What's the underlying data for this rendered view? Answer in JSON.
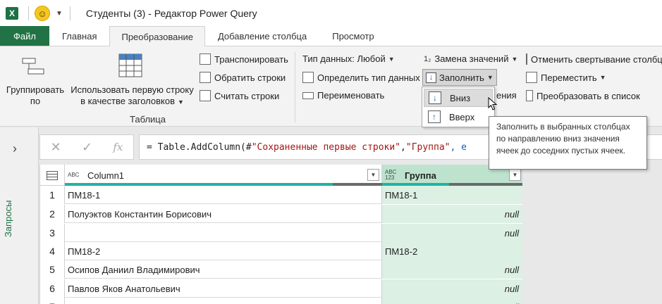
{
  "titlebar": {
    "app_icon": "excel-icon",
    "title": "Студенты (3) - Редактор Power Query"
  },
  "tabs": [
    {
      "label": "Файл"
    },
    {
      "label": "Главная"
    },
    {
      "label": "Преобразование"
    },
    {
      "label": "Добавление столбца"
    },
    {
      "label": "Просмотр"
    }
  ],
  "ribbon": {
    "group_by": "Группировать по",
    "group_by_l1": "Группировать",
    "group_by_l2": "по",
    "use_first_row_l1": "Использовать первую строку",
    "use_first_row_l2": "в качестве заголовков",
    "table_group_label": "Таблица",
    "transpose": "Транспонировать",
    "reverse_rows": "Обратить строки",
    "count_rows": "Считать строки",
    "data_type": "Тип данных: Любой",
    "detect_type": "Определить тип данных",
    "rename": "Переименовать",
    "replace_values": "Замена значений",
    "fill": "Заполнить",
    "partial_hidden": "ения",
    "unpivot": "Отменить свертывание столбцов",
    "move": "Переместить",
    "to_list": "Преобразовать в список"
  },
  "fill_menu": {
    "down": "Вниз",
    "up": "Вверх"
  },
  "tooltip": "Заполнить в выбранных столбцах по направлению вниз значения ячеек до соседних пустых ячеек.",
  "left_pane": {
    "queries_label": "Запросы"
  },
  "formula": {
    "prefix": "= Table.AddColumn(#",
    "str1": "\"Сохраненные первые строки\"",
    "mid": ", ",
    "str2": "\"Группа\"",
    "tail": ", e"
  },
  "grid": {
    "columns": [
      {
        "type_badge": "ABC",
        "name": "Column1"
      },
      {
        "type_badge": "ABC 123",
        "name": "Группа"
      }
    ],
    "rows": [
      {
        "n": "1",
        "c1": "ПМ18-1",
        "c2": "ПМ18-1"
      },
      {
        "n": "2",
        "c1": "Полуэктов Константин Борисович",
        "c2": "null"
      },
      {
        "n": "3",
        "c1": "",
        "c2": "null"
      },
      {
        "n": "4",
        "c1": "ПМ18-2",
        "c2": "ПМ18-2"
      },
      {
        "n": "5",
        "c1": "Осипов Даниил Владимирович",
        "c2": "null"
      },
      {
        "n": "6",
        "c1": "Павлов Яков Анатольевич",
        "c2": "null"
      },
      {
        "n": "7",
        "c1": "",
        "c2": "null"
      }
    ]
  },
  "colors": {
    "accent": "#217346",
    "selected_col": "#bde3cf",
    "selected_cell": "#dcf0e4",
    "quality_bar": "#20b3a3"
  }
}
